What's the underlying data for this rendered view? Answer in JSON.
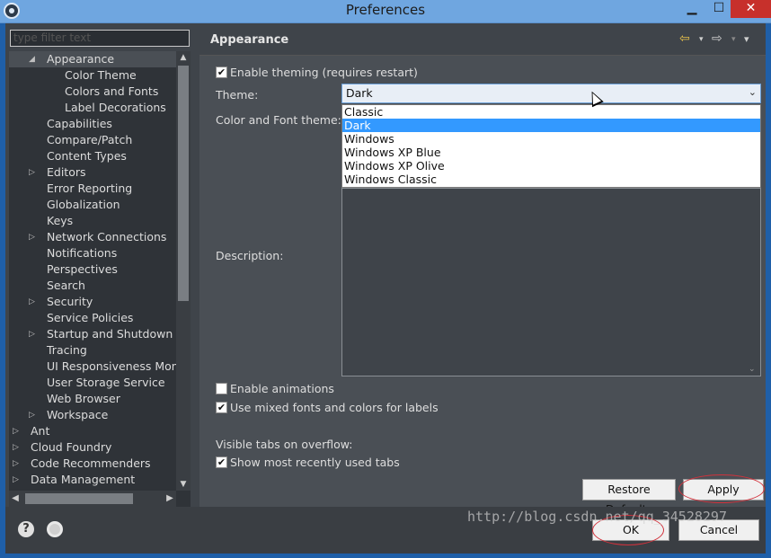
{
  "window": {
    "title": "Preferences",
    "minimize_glyph": "▁",
    "maximize_glyph": "☐",
    "close_glyph": "✕"
  },
  "filter": {
    "placeholder": "type filter text"
  },
  "tree": {
    "items": [
      {
        "label": "Appearance",
        "arrow": "◢",
        "indent": 1,
        "selected": true
      },
      {
        "label": "Color Theme",
        "arrow": "",
        "indent": 2
      },
      {
        "label": "Colors and Fonts",
        "arrow": "",
        "indent": 2
      },
      {
        "label": "Label Decorations",
        "arrow": "",
        "indent": 2
      },
      {
        "label": "Capabilities",
        "arrow": "",
        "indent": 1
      },
      {
        "label": "Compare/Patch",
        "arrow": "",
        "indent": 1
      },
      {
        "label": "Content Types",
        "arrow": "",
        "indent": 1
      },
      {
        "label": "Editors",
        "arrow": "▷",
        "indent": 1
      },
      {
        "label": "Error Reporting",
        "arrow": "",
        "indent": 1
      },
      {
        "label": "Globalization",
        "arrow": "",
        "indent": 1
      },
      {
        "label": "Keys",
        "arrow": "",
        "indent": 1
      },
      {
        "label": "Network Connections",
        "arrow": "▷",
        "indent": 1
      },
      {
        "label": "Notifications",
        "arrow": "",
        "indent": 1
      },
      {
        "label": "Perspectives",
        "arrow": "",
        "indent": 1
      },
      {
        "label": "Search",
        "arrow": "",
        "indent": 1
      },
      {
        "label": "Security",
        "arrow": "▷",
        "indent": 1
      },
      {
        "label": "Service Policies",
        "arrow": "",
        "indent": 1
      },
      {
        "label": "Startup and Shutdown",
        "arrow": "▷",
        "indent": 1
      },
      {
        "label": "Tracing",
        "arrow": "",
        "indent": 1
      },
      {
        "label": "UI Responsiveness Mon",
        "arrow": "",
        "indent": 1
      },
      {
        "label": "User Storage Service",
        "arrow": "",
        "indent": 1
      },
      {
        "label": "Web Browser",
        "arrow": "",
        "indent": 1
      },
      {
        "label": "Workspace",
        "arrow": "▷",
        "indent": 1
      },
      {
        "label": "Ant",
        "arrow": "▷",
        "indent": 0
      },
      {
        "label": "Cloud Foundry",
        "arrow": "▷",
        "indent": 0
      },
      {
        "label": "Code Recommenders",
        "arrow": "▷",
        "indent": 0
      },
      {
        "label": "Data Management",
        "arrow": "▷",
        "indent": 0
      }
    ]
  },
  "page": {
    "title": "Appearance",
    "nav_back": "⇦",
    "nav_forward": "⇨",
    "nav_menu": "▾",
    "enable_theming_label": "Enable theming (requires restart)",
    "enable_theming_checked": "✔",
    "theme_label": "Theme:",
    "theme_value": "Dark",
    "theme_caret": "⌄",
    "theme_options": [
      "Classic",
      "Dark",
      "Windows",
      "Windows XP Blue",
      "Windows XP Olive",
      "Windows Classic"
    ],
    "theme_selected_index": 1,
    "color_font_theme_label": "Color and Font theme:",
    "description_label": "Description:",
    "enable_animations_label": "Enable animations",
    "mixed_fonts_label": "Use mixed fonts and colors for labels",
    "mixed_fonts_checked": "✔",
    "visible_tabs_label": "Visible tabs on overflow:",
    "recent_tabs_label": "Show most recently used tabs",
    "recent_tabs_checked": "✔",
    "restore_defaults_label": "Restore Defaults",
    "apply_label": "Apply"
  },
  "footer": {
    "help_glyph": "?",
    "ok_label": "OK",
    "cancel_label": "Cancel"
  },
  "watermark": "http://blog.csdn.net/qq_34528297"
}
